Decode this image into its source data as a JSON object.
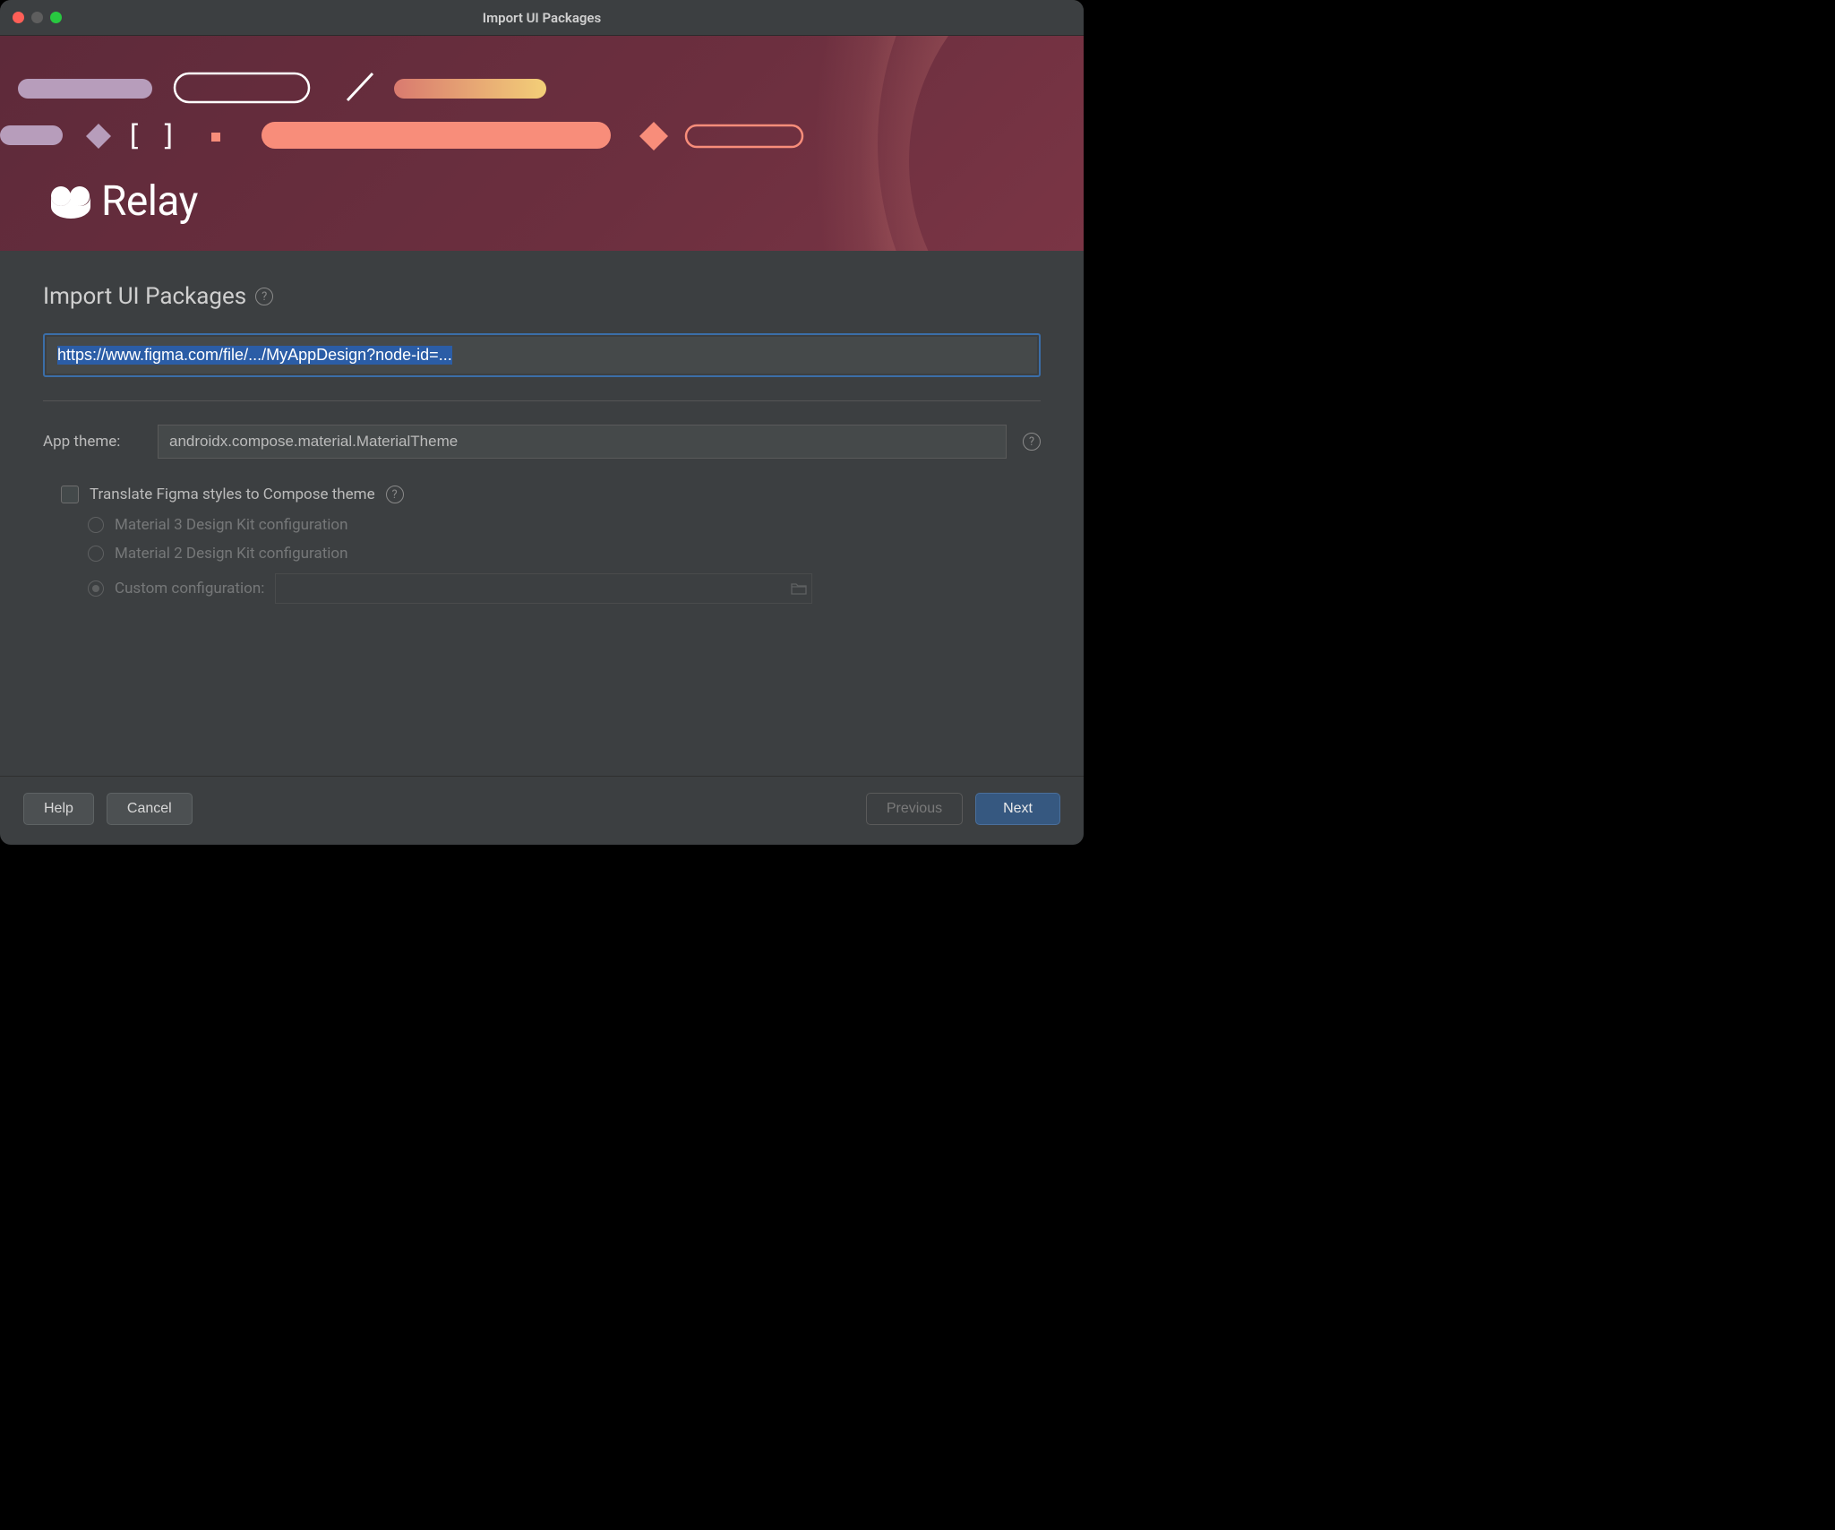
{
  "window": {
    "title": "Import UI Packages"
  },
  "banner": {
    "logo_text": "Relay"
  },
  "main": {
    "heading": "Import UI Packages",
    "url_placeholder": "https://www.figma.com/file/.../MyAppDesign?node-id=...",
    "theme_label": "App theme:",
    "theme_value": "androidx.compose.material.MaterialTheme",
    "translate_label": "Translate Figma styles to Compose theme",
    "translate_checked": false,
    "radio_options": [
      {
        "label": "Material 3 Design Kit configuration",
        "selected": false
      },
      {
        "label": "Material 2 Design Kit configuration",
        "selected": false
      },
      {
        "label": "Custom configuration:",
        "selected": true,
        "has_path": true
      }
    ],
    "custom_path": ""
  },
  "footer": {
    "help": "Help",
    "cancel": "Cancel",
    "previous": "Previous",
    "next": "Next"
  }
}
